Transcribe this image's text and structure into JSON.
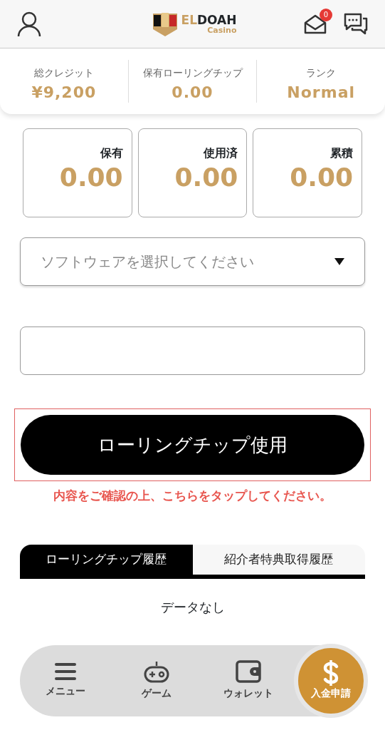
{
  "header": {
    "logo": {
      "prefix": "EL",
      "name": "DOAH",
      "sub": "Casino"
    },
    "mail_badge": "0"
  },
  "stats": [
    {
      "label": "総クレジット",
      "value": "¥9,200"
    },
    {
      "label": "保有ローリングチップ",
      "value": "0.00"
    },
    {
      "label": "ランク",
      "value": "Normal"
    }
  ],
  "chip_boxes": [
    {
      "label": "保有",
      "value": "0.00"
    },
    {
      "label": "使用済",
      "value": "0.00"
    },
    {
      "label": "累積",
      "value": "0.00"
    }
  ],
  "software_select": {
    "placeholder": "ソフトウェアを選択してください"
  },
  "use_button": {
    "label": "ローリングチップ使用",
    "highlighted": true
  },
  "notice": "内容をご確認の上、こちらをタップしてください。",
  "tabs": [
    {
      "label": "ローリングチップ履歴",
      "selected": true
    },
    {
      "label": "紹介者特典取得履歴",
      "selected": false
    }
  ],
  "empty_message": "データなし",
  "bottom_nav": [
    {
      "label": "メニュー",
      "kind": "plain"
    },
    {
      "label": "ゲーム",
      "kind": "plain"
    },
    {
      "label": "ウォレット",
      "kind": "plain"
    },
    {
      "label": "入金申請",
      "kind": "primary"
    }
  ]
}
